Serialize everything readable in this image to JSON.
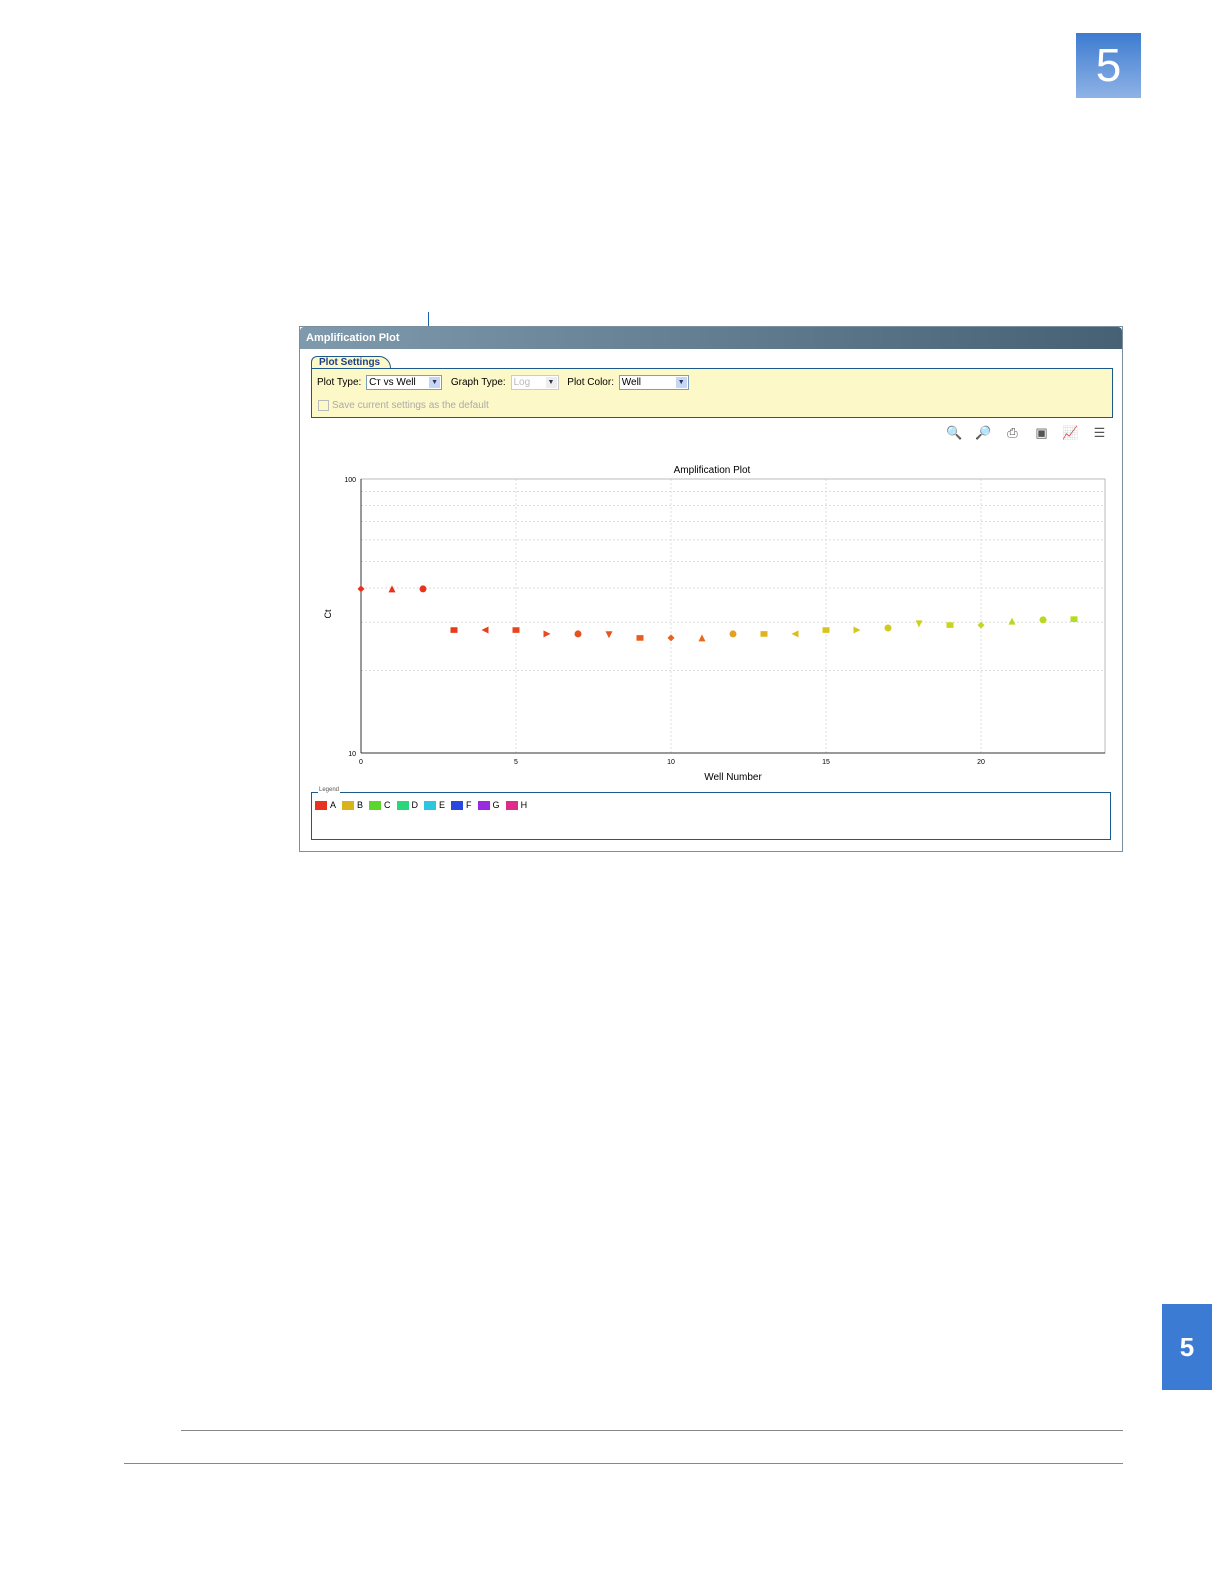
{
  "chapter_number": "5",
  "side_tab": "5",
  "window": {
    "title": "Amplification Plot",
    "settings_tab": "Plot Settings",
    "plot_type_label": "Plot Type:",
    "plot_type_value": "Cт vs Well",
    "graph_type_label": "Graph Type:",
    "graph_type_value": "Log",
    "plot_color_label": "Plot Color:",
    "plot_color_value": "Well",
    "save_default_label": "Save current settings as the default",
    "tools": [
      "zoom-in-icon",
      "zoom-out-icon",
      "print-icon",
      "save-image-icon",
      "plot-properties-icon",
      "legend-icon"
    ]
  },
  "legend": {
    "title": "Legend",
    "items": [
      {
        "label": "A",
        "color": "#e8321e"
      },
      {
        "label": "B",
        "color": "#d8b41a"
      },
      {
        "label": "C",
        "color": "#5cd62a"
      },
      {
        "label": "D",
        "color": "#2ad67a"
      },
      {
        "label": "E",
        "color": "#2ac8e0"
      },
      {
        "label": "F",
        "color": "#2a46e0"
      },
      {
        "label": "G",
        "color": "#9a2ae0"
      },
      {
        "label": "H",
        "color": "#e02a8a"
      }
    ]
  },
  "chart_data": {
    "type": "scatter",
    "title": "Amplification Plot",
    "xlabel": "Well Number",
    "ylabel": "Ct",
    "yscale": "log",
    "xlim": [
      0,
      24
    ],
    "ylim": [
      10,
      100
    ],
    "xticks": [
      "0",
      "5",
      "10",
      "15",
      "20"
    ],
    "yticks": [
      "10",
      "100"
    ],
    "grid": true,
    "x": [
      0,
      1,
      2,
      3,
      4,
      5,
      6,
      7,
      8,
      9,
      10,
      11,
      12,
      13,
      14,
      15,
      16,
      17,
      18,
      19,
      20,
      21,
      22,
      23
    ],
    "y": [
      39.7,
      39.7,
      39.7,
      28.1,
      28.1,
      28.1,
      27.2,
      27.2,
      27.0,
      26.3,
      26.3,
      26.3,
      27.2,
      27.2,
      27.2,
      28.1,
      28.1,
      28.6,
      29.6,
      29.3,
      29.3,
      30.3,
      30.6,
      30.8
    ],
    "shapes": [
      "diamond",
      "triangle",
      "circle",
      "square",
      "left",
      "square",
      "right",
      "circle",
      "down",
      "square",
      "diamond",
      "triangle",
      "circle",
      "square",
      "left",
      "square",
      "right",
      "circle",
      "down",
      "square",
      "diamond",
      "triangle",
      "circle",
      "square"
    ],
    "colors": [
      "#e8321e",
      "#e8321e",
      "#e8321e",
      "#e8381e",
      "#e83e1e",
      "#e8441e",
      "#e84a1e",
      "#e8501e",
      "#e8561e",
      "#e85c1e",
      "#e8621e",
      "#e8681e",
      "#e6a01e",
      "#e2b21e",
      "#dcbc1e",
      "#d8c41e",
      "#d4c81e",
      "#d0cc1e",
      "#ccd01e",
      "#c8d41e",
      "#c4d61e",
      "#bcd81e",
      "#b8da1e",
      "#b4dc1e"
    ]
  }
}
